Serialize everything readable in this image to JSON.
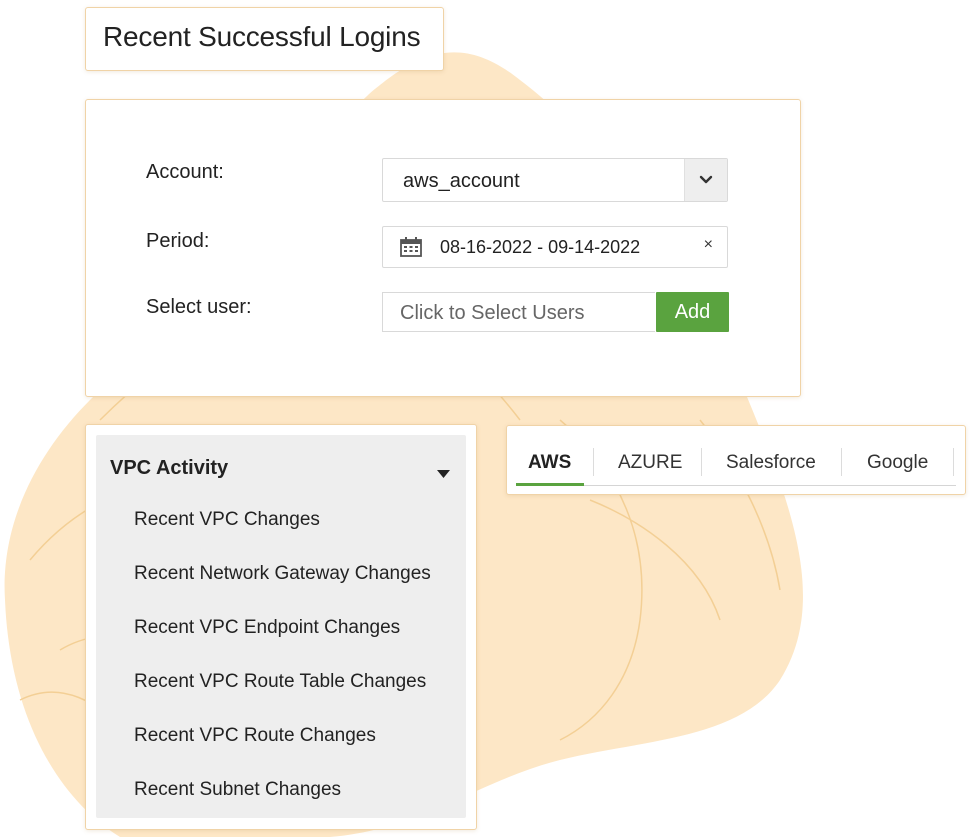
{
  "page": {
    "title": "Recent Successful Logins"
  },
  "form": {
    "account_label": "Account:",
    "account_value": "aws_account",
    "period_label": "Period:",
    "period_value": "08-16-2022 - 09-14-2022",
    "clear_label": "×",
    "user_label": "Select user:",
    "user_placeholder": "Click to Select Users",
    "add_label": "Add"
  },
  "menu": {
    "heading": "VPC Activity",
    "items": [
      {
        "label": "Recent VPC Changes"
      },
      {
        "label": "Recent Network Gateway Changes"
      },
      {
        "label": "Recent VPC Endpoint Changes"
      },
      {
        "label": "Recent VPC Route Table Changes"
      },
      {
        "label": "Recent VPC Route Changes"
      },
      {
        "label": "Recent Subnet Changes"
      }
    ]
  },
  "tabs": [
    {
      "label": "AWS",
      "active": true
    },
    {
      "label": "AZURE",
      "active": false
    },
    {
      "label": "Salesforce",
      "active": false
    },
    {
      "label": "Google",
      "active": false
    }
  ],
  "colors": {
    "accent_green": "#5aa33f",
    "background_blob": "#fde7c6",
    "blob_lines": "#f3cf95"
  },
  "icons": {
    "account_dropdown": "chevron-down-icon",
    "period_calendar": "calendar-icon",
    "period_clear": "close-icon",
    "menu_toggle": "caret-down-icon"
  }
}
